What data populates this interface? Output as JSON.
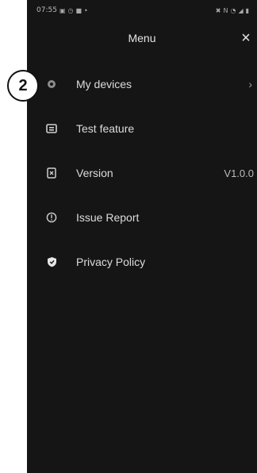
{
  "status_bar": {
    "time": "07:55",
    "left_icons": [
      "gallery-icon",
      "clock-icon",
      "message-icon",
      "dot-icon"
    ],
    "right_icons": [
      "mute-icon",
      "nfc-icon",
      "wifi-icon",
      "signal-icon",
      "battery-icon"
    ]
  },
  "header": {
    "title": "Menu",
    "close_glyph": "×"
  },
  "menu": {
    "items": [
      {
        "label": "My devices",
        "icon": "device-icon",
        "trailing": "›"
      },
      {
        "label": "Test feature",
        "icon": "test-icon",
        "trailing": ""
      },
      {
        "label": "Version",
        "icon": "version-icon",
        "trailing": "V1.0.0"
      },
      {
        "label": "Issue Report",
        "icon": "info-icon",
        "trailing": ""
      },
      {
        "label": "Privacy Policy",
        "icon": "shield-icon",
        "trailing": ""
      }
    ]
  },
  "annotation": {
    "badge_number": "2"
  },
  "colors": {
    "background": "#151515",
    "text": "#dcdcdc",
    "muted": "#9e9e9e"
  }
}
